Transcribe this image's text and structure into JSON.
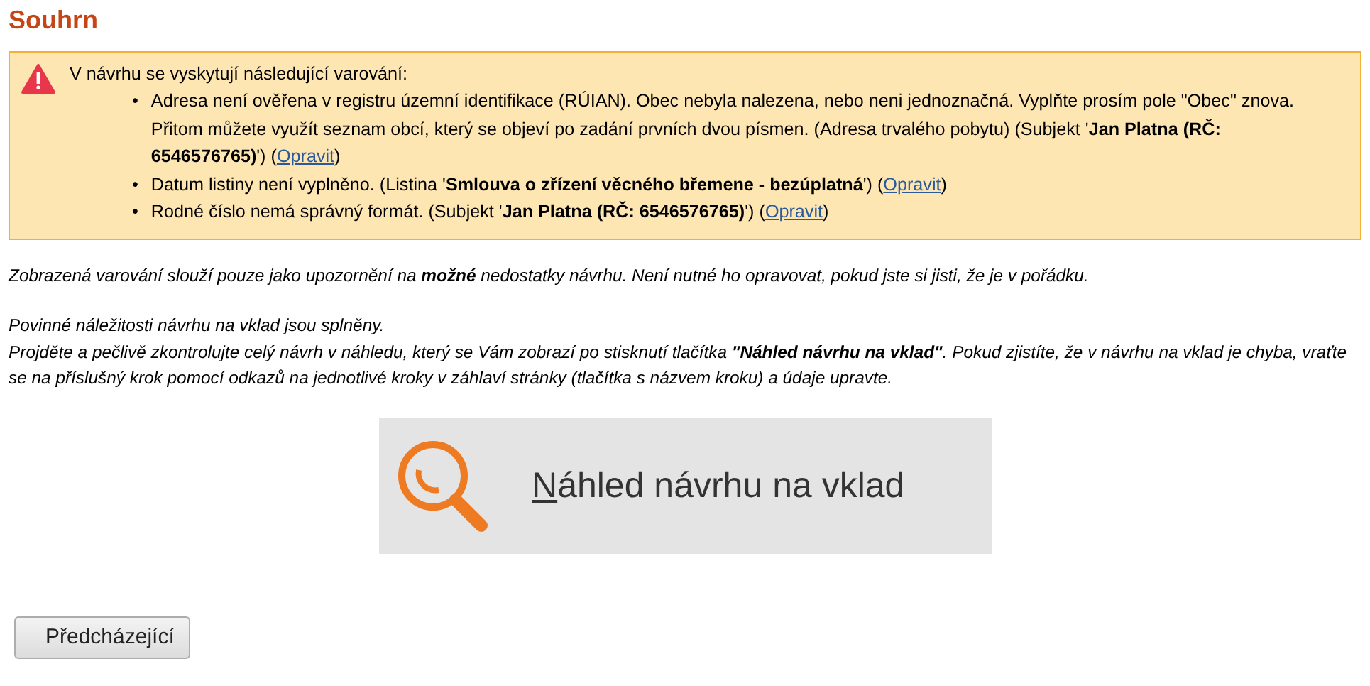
{
  "title": "Souhrn",
  "warning_box": {
    "heading": "V návrhu se vyskytují následující varování:",
    "items": [
      {
        "bullet": "•",
        "text": "Adresa není ověřena v registru územní identifikace (RÚIAN). Obec nebyla nalezena, nebo neni jednoznačná. Vyplňte prosím pole \"Obec\" znova. Přitom můžete využít seznam obcí, který se objeví po zadání prvních dvou písmen. (Adresa trvalého pobytu) (Subjekt '**Jan Platna (RČ: 6546576765)**') (",
        "link": "Opravit",
        "after": ")"
      },
      {
        "bullet": "•",
        "text": "Datum listiny není vyplněno. (Listina '**Smlouva o zřízení věcného břemene - bezúplatná**') (",
        "link": "Opravit",
        "after": ")"
      },
      {
        "bullet": "•",
        "text": "Rodné číslo nemá správný formát. (Subjekt '**Jan Platna (RČ: 6546576765)**') (",
        "link": "Opravit",
        "after": ")"
      }
    ]
  },
  "notes": [
    "Zobrazená varování slouží pouze jako upozornění na **možné** nedostatky návrhu. Není nutné ho opravovat, pokud jste si jisti, že je v pořádku.",
    "Povinné náležitosti návrhu na vklad jsou splněny.",
    "Projděte a pečlivě zkontrolujte celý návrh v náhledu, který se Vám zobrazí po stisknutí tlačítka **\"Náhled návrhu na vklad\"**. Pokud zjistíte, že v návrhu na vklad je chyba, vraťte se na příslušný krok pomocí odkazů na jednotlivé kroky v záhlaví stránky (tlačítka s názvem kroku) a údaje upravte."
  ],
  "preview_button": "Náhled návrhu na vklad",
  "previous_button": "Předcházející"
}
